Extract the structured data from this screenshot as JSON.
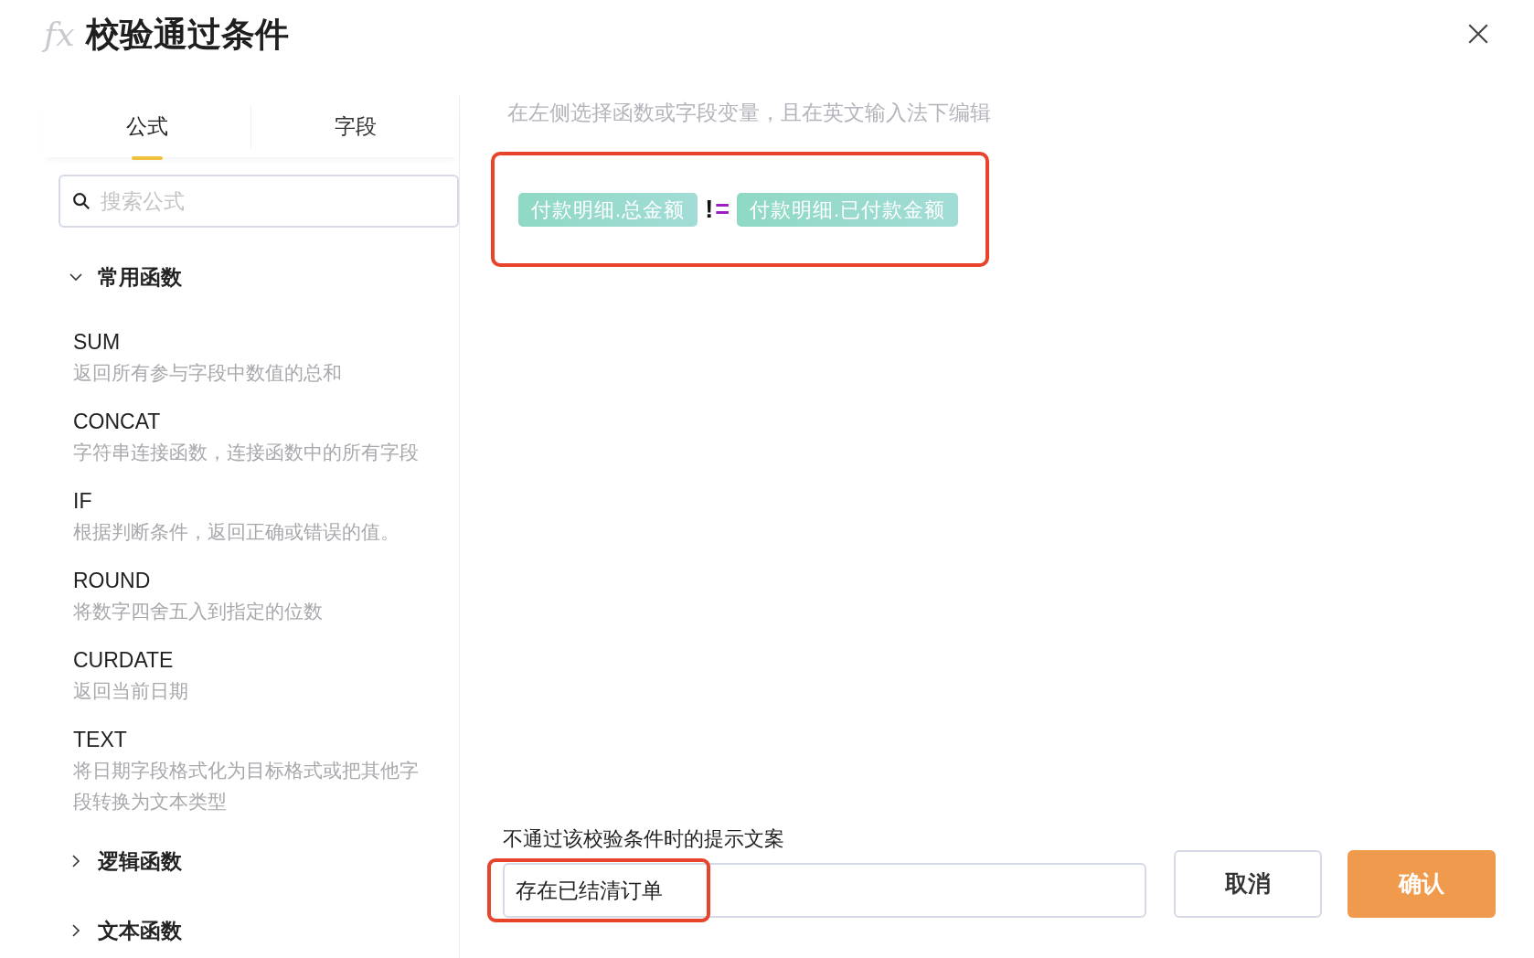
{
  "dialog": {
    "icon_text": "fx",
    "title": "校验通过条件"
  },
  "tabs": [
    {
      "label": "公式",
      "selected": true
    },
    {
      "label": "字段",
      "selected": false
    }
  ],
  "search": {
    "placeholder": "搜索公式"
  },
  "groups": [
    {
      "label": "常用函数",
      "expanded": true,
      "items": [
        {
          "name": "SUM",
          "description": "返回所有参与字段中数值的总和"
        },
        {
          "name": "CONCAT",
          "description": "字符串连接函数，连接函数中的所有字段"
        },
        {
          "name": "IF",
          "description": "根据判断条件，返回正确或错误的值。"
        },
        {
          "name": "ROUND",
          "description": "将数字四舍五入到指定的位数"
        },
        {
          "name": "CURDATE",
          "description": "返回当前日期"
        },
        {
          "name": "TEXT",
          "description": "将日期字段格式化为目标格式或把其他字段转换为文本类型"
        }
      ]
    },
    {
      "label": "逻辑函数",
      "expanded": false
    },
    {
      "label": "文本函数",
      "expanded": false
    }
  ],
  "editor": {
    "hint": "在左侧选择函数或字段变量，且在英文输入法下编辑",
    "tokens": [
      {
        "kind": "field",
        "text": "付款明细.总金额"
      },
      {
        "kind": "operator",
        "text": "!",
        "color": "#111111"
      },
      {
        "kind": "operator",
        "text": "=",
        "color": "#9b1fc0"
      },
      {
        "kind": "field",
        "text": "付款明细.已付款金额"
      }
    ]
  },
  "message": {
    "label": "不通过该校验条件时的提示文案",
    "value": "存在已结清订单"
  },
  "buttons": [
    {
      "label": "取消",
      "kind": "secondary"
    },
    {
      "label": "确认",
      "kind": "primary"
    }
  ]
}
